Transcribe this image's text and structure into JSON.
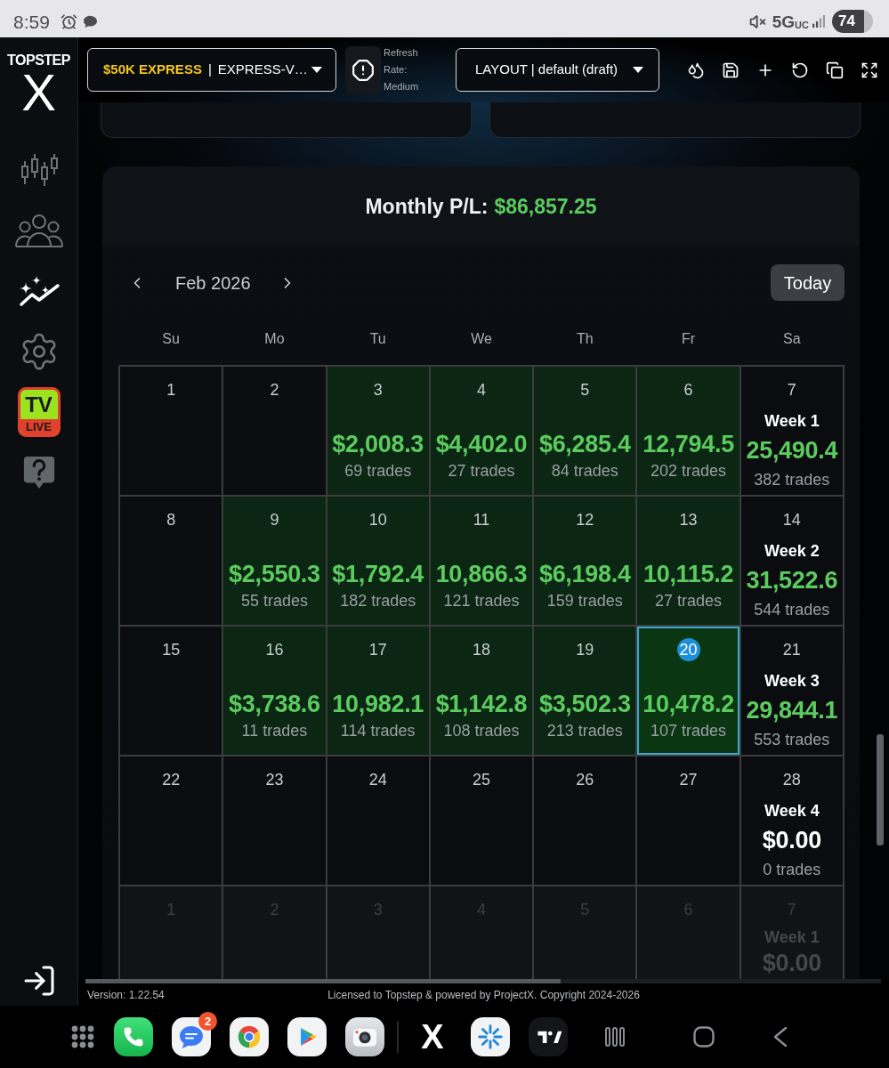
{
  "status_bar": {
    "time": "8:59",
    "network": "5G",
    "network_suffix": "UC",
    "battery": "74"
  },
  "sidebar": {
    "logo_word": "TOPSTEP",
    "logo_mark": "X",
    "items": [
      {
        "kind": "icon",
        "selected": false
      },
      {
        "kind": "icon",
        "selected": false
      },
      {
        "kind": "icon",
        "selected": true
      },
      {
        "kind": "icon",
        "selected": false
      },
      {
        "kind": "badge",
        "selected": false,
        "label": "TV",
        "sublabel": "LIVE"
      },
      {
        "kind": "icon",
        "selected": false
      }
    ]
  },
  "header": {
    "account": {
      "plan": "$50K EXPRESS",
      "separator": "|",
      "name": "EXPRESS-V…"
    },
    "refresh_rate": "Refresh Rate: Medium",
    "layout": "LAYOUT | default (draft)"
  },
  "calendar": {
    "monthly_pl": {
      "label": "Monthly P/L:",
      "value": "$86,857.25"
    },
    "month": "Feb 2026",
    "today_button": "Today",
    "weekdays": [
      "Su",
      "Mo",
      "Tu",
      "We",
      "Th",
      "Fr",
      "Sa"
    ],
    "weeks": [
      {
        "outside_month": false,
        "days": [
          {
            "date": "1",
            "kind": "blank",
            "selected": false
          },
          {
            "date": "2",
            "kind": "blank",
            "selected": false
          },
          {
            "date": "3",
            "kind": "gain",
            "pnl": "$2,008.3",
            "trades": "69 trades",
            "selected": false
          },
          {
            "date": "4",
            "kind": "gain",
            "pnl": "$4,402.0",
            "trades": "27 trades",
            "selected": false
          },
          {
            "date": "5",
            "kind": "gain",
            "pnl": "$6,285.4",
            "trades": "84 trades",
            "selected": false
          },
          {
            "date": "6",
            "kind": "gain",
            "pnl": "12,794.5",
            "trades": "202 trades",
            "selected": false
          },
          {
            "date": "7",
            "kind": "blank",
            "selected": false
          }
        ],
        "summary": {
          "label": "Week 1",
          "kind": "gain",
          "pnl": "25,490.4",
          "trades": "382 trades"
        }
      },
      {
        "outside_month": false,
        "days": [
          {
            "date": "8",
            "kind": "blank",
            "selected": false
          },
          {
            "date": "9",
            "kind": "gain",
            "pnl": "$2,550.3",
            "trades": "55 trades",
            "selected": false
          },
          {
            "date": "10",
            "kind": "gain",
            "pnl": "$1,792.4",
            "trades": "182 trades",
            "selected": false
          },
          {
            "date": "11",
            "kind": "gain",
            "pnl": "10,866.3",
            "trades": "121 trades",
            "selected": false
          },
          {
            "date": "12",
            "kind": "gain",
            "pnl": "$6,198.4",
            "trades": "159 trades",
            "selected": false
          },
          {
            "date": "13",
            "kind": "gain",
            "pnl": "10,115.2",
            "trades": "27 trades",
            "selected": false
          },
          {
            "date": "14",
            "kind": "blank",
            "selected": false
          }
        ],
        "summary": {
          "label": "Week 2",
          "kind": "gain",
          "pnl": "31,522.6",
          "trades": "544 trades"
        }
      },
      {
        "outside_month": false,
        "days": [
          {
            "date": "15",
            "kind": "blank",
            "selected": false
          },
          {
            "date": "16",
            "kind": "gain",
            "pnl": "$3,738.6",
            "trades": "11 trades",
            "selected": false
          },
          {
            "date": "17",
            "kind": "gain",
            "pnl": "10,982.1",
            "trades": "114 trades",
            "selected": false
          },
          {
            "date": "18",
            "kind": "gain",
            "pnl": "$1,142.8",
            "trades": "108 trades",
            "selected": false
          },
          {
            "date": "19",
            "kind": "gain",
            "pnl": "$3,502.3",
            "trades": "213 trades",
            "selected": false
          },
          {
            "date": "20",
            "kind": "gain",
            "pnl": "10,478.2",
            "trades": "107 trades",
            "selected": true
          },
          {
            "date": "21",
            "kind": "blank",
            "selected": false
          }
        ],
        "summary": {
          "label": "Week 3",
          "kind": "gain",
          "pnl": "29,844.1",
          "trades": "553 trades"
        }
      },
      {
        "outside_month": false,
        "days": [
          {
            "date": "22",
            "kind": "blank",
            "selected": false
          },
          {
            "date": "23",
            "kind": "blank",
            "selected": false
          },
          {
            "date": "24",
            "kind": "blank",
            "selected": false
          },
          {
            "date": "25",
            "kind": "blank",
            "selected": false
          },
          {
            "date": "26",
            "kind": "blank",
            "selected": false
          },
          {
            "date": "27",
            "kind": "blank",
            "selected": false
          },
          {
            "date": "28",
            "kind": "blank",
            "selected": false
          }
        ],
        "summary": {
          "label": "Week 4",
          "kind": "flat",
          "pnl": "$0.00",
          "trades": "0 trades"
        }
      },
      {
        "outside_month": true,
        "days": [
          {
            "date": "1",
            "kind": "blank",
            "selected": false
          },
          {
            "date": "2",
            "kind": "blank",
            "selected": false
          },
          {
            "date": "3",
            "kind": "blank",
            "selected": false
          },
          {
            "date": "4",
            "kind": "blank",
            "selected": false
          },
          {
            "date": "5",
            "kind": "blank",
            "selected": false
          },
          {
            "date": "6",
            "kind": "blank",
            "selected": false
          },
          {
            "date": "7",
            "kind": "blank",
            "selected": false
          }
        ],
        "summary": {
          "label": "Week 1",
          "kind": "flat",
          "pnl": "$0.00"
        }
      }
    ]
  },
  "footer": {
    "version": "Version: 1.22.54",
    "license": "Licensed to Topstep & powered by ProjectX. Copyright 2024-2026"
  },
  "taskbar": {
    "badge": "2",
    "x_app": "X"
  }
}
